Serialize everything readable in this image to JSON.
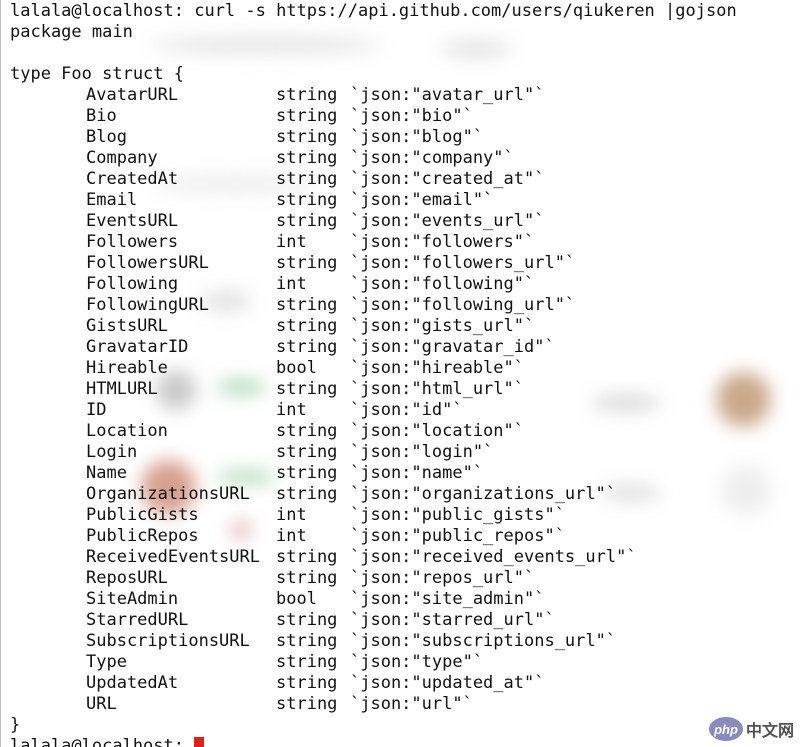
{
  "command_prompt": "lalala@localhost: curl -s https://api.github.com/users/qiukeren |gojson",
  "package_line": "package main",
  "type_open": "type Foo struct {",
  "fields": [
    {
      "name": "AvatarURL",
      "type": "string",
      "tag": "`json:\"avatar_url\"`"
    },
    {
      "name": "Bio",
      "type": "string",
      "tag": "`json:\"bio\"`"
    },
    {
      "name": "Blog",
      "type": "string",
      "tag": "`json:\"blog\"`"
    },
    {
      "name": "Company",
      "type": "string",
      "tag": "`json:\"company\"`"
    },
    {
      "name": "CreatedAt",
      "type": "string",
      "tag": "`json:\"created_at\"`"
    },
    {
      "name": "Email",
      "type": "string",
      "tag": "`json:\"email\"`"
    },
    {
      "name": "EventsURL",
      "type": "string",
      "tag": "`json:\"events_url\"`"
    },
    {
      "name": "Followers",
      "type": "int",
      "tag": "`json:\"followers\"`"
    },
    {
      "name": "FollowersURL",
      "type": "string",
      "tag": "`json:\"followers_url\"`"
    },
    {
      "name": "Following",
      "type": "int",
      "tag": "`json:\"following\"`"
    },
    {
      "name": "FollowingURL",
      "type": "string",
      "tag": "`json:\"following_url\"`"
    },
    {
      "name": "GistsURL",
      "type": "string",
      "tag": "`json:\"gists_url\"`"
    },
    {
      "name": "GravatarID",
      "type": "string",
      "tag": "`json:\"gravatar_id\"`"
    },
    {
      "name": "Hireable",
      "type": "bool",
      "tag": "`json:\"hireable\"`"
    },
    {
      "name": "HTMLURL",
      "type": "string",
      "tag": "`json:\"html_url\"`"
    },
    {
      "name": "ID",
      "type": "int",
      "tag": "`json:\"id\"`"
    },
    {
      "name": "Location",
      "type": "string",
      "tag": "`json:\"location\"`"
    },
    {
      "name": "Login",
      "type": "string",
      "tag": "`json:\"login\"`"
    },
    {
      "name": "Name",
      "type": "string",
      "tag": "`json:\"name\"`"
    },
    {
      "name": "OrganizationsURL",
      "type": "string",
      "tag": "`json:\"organizations_url\"`"
    },
    {
      "name": "PublicGists",
      "type": "int",
      "tag": "`json:\"public_gists\"`"
    },
    {
      "name": "PublicRepos",
      "type": "int",
      "tag": "`json:\"public_repos\"`"
    },
    {
      "name": "ReceivedEventsURL",
      "type": "string",
      "tag": "`json:\"received_events_url\"`"
    },
    {
      "name": "ReposURL",
      "type": "string",
      "tag": "`json:\"repos_url\"`"
    },
    {
      "name": "SiteAdmin",
      "type": "bool",
      "tag": "`json:\"site_admin\"`"
    },
    {
      "name": "StarredURL",
      "type": "string",
      "tag": "`json:\"starred_url\"`"
    },
    {
      "name": "SubscriptionsURL",
      "type": "string",
      "tag": "`json:\"subscriptions_url\"`"
    },
    {
      "name": "Type",
      "type": "string",
      "tag": "`json:\"type\"`"
    },
    {
      "name": "UpdatedAt",
      "type": "string",
      "tag": "`json:\"updated_at\"`"
    },
    {
      "name": "URL",
      "type": "string",
      "tag": "`json:\"url\"`"
    }
  ],
  "type_close": "}",
  "final_prompt": "lalala@localhost: ",
  "cursor_color": "#e0201b",
  "watermark": {
    "logo_text": "php",
    "site_text": "中文网"
  }
}
